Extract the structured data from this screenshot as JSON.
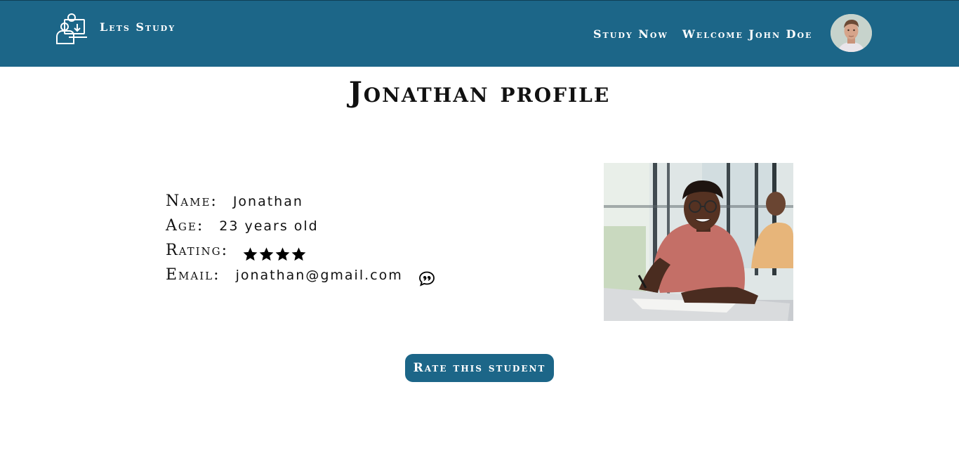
{
  "header": {
    "brand_text": "Lets Study",
    "nav": {
      "study_now": "Study Now",
      "welcome": "Welcome John Doe"
    },
    "avatar_icon": "user-avatar"
  },
  "profile": {
    "title": "Jonathan profile",
    "fields": {
      "name_label": "Name:",
      "name_value": "Jonathan",
      "age_label": "Age:",
      "age_value": "23 years old",
      "rating_label": "Rating:",
      "rating_stars": 4,
      "email_label": "Email:",
      "email_value": "jonathan@gmail.com"
    },
    "photo_alt": "student-photo",
    "rate_button": "Rate this student"
  },
  "colors": {
    "primary": "#1c6688",
    "text": "#111111",
    "background": "#ffffff"
  }
}
